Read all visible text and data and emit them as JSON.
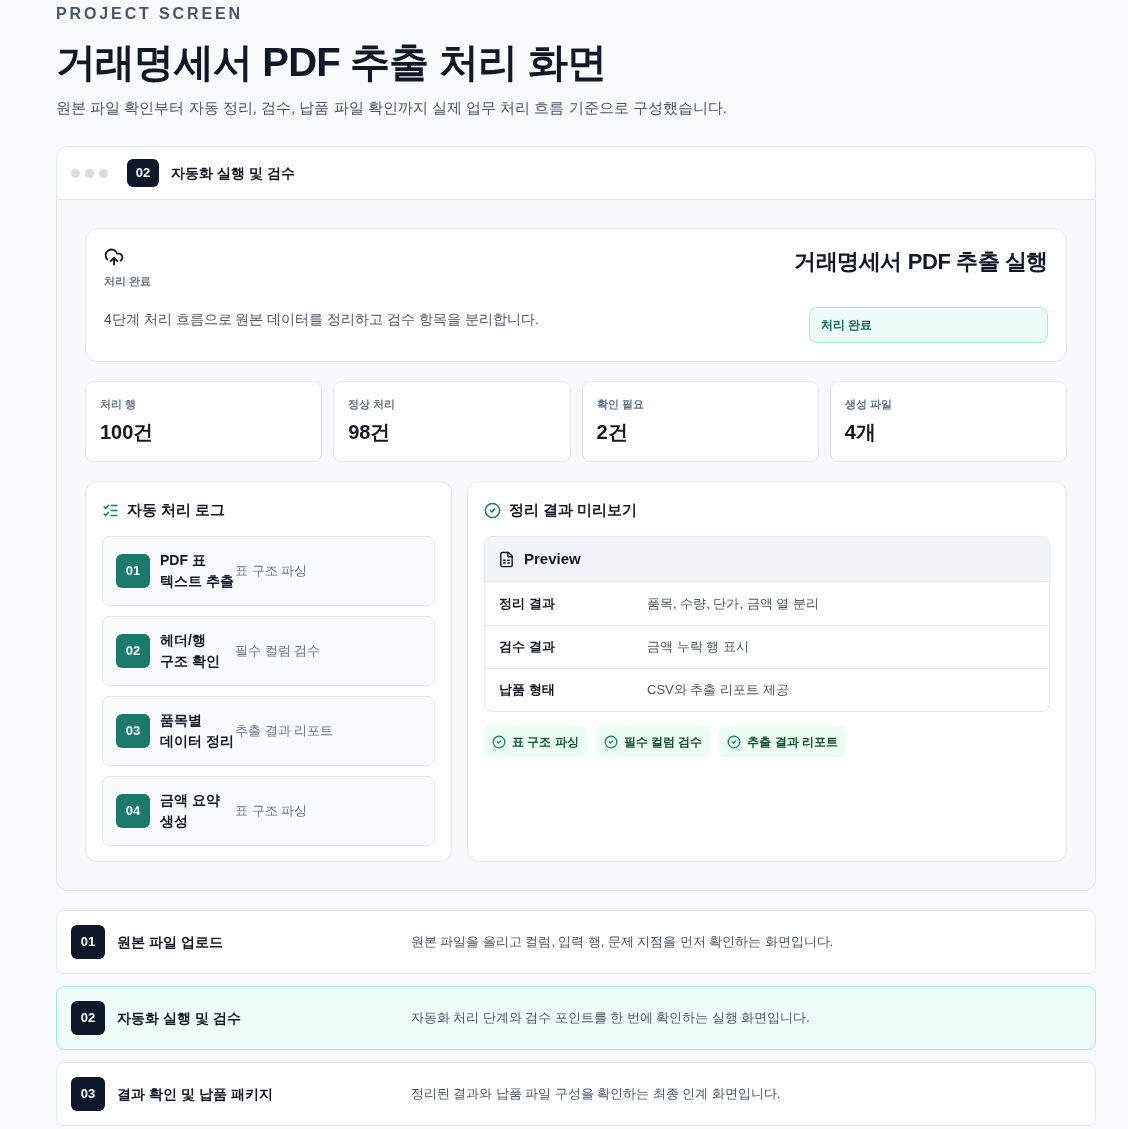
{
  "header": {
    "eyebrow": "PROJECT SCREEN",
    "title": "거래명세서 PDF 추출 처리 화면",
    "subtitle": "원본 파일 확인부터 자동 정리, 검수, 납품 파일 확인까지 실제 업무 처리 흐름 기준으로 구성했습니다."
  },
  "panel": {
    "badge": "02",
    "title": "자동화 실행 및 검수"
  },
  "summary": {
    "label": "처리 완료",
    "description": "4단계 처리 흐름으로 원본 데이터를 정리하고 검수 항목을 분리합니다.",
    "title": "거래명세서 PDF 추출 실행",
    "status": "처리 완료"
  },
  "stats": [
    {
      "label": "처리 행",
      "value": "100건"
    },
    {
      "label": "정상 처리",
      "value": "98건"
    },
    {
      "label": "확인 필요",
      "value": "2건"
    },
    {
      "label": "생성 파일",
      "value": "4개"
    }
  ],
  "log": {
    "title": "자동 처리 로그",
    "steps": [
      {
        "number": "01",
        "title": "PDF 표 텍스트 추출",
        "description": "표 구조 파싱"
      },
      {
        "number": "02",
        "title": "헤더/행 구조 확인",
        "description": "필수 컬럼 검수"
      },
      {
        "number": "03",
        "title": "품목별 데이터 정리",
        "description": "추출 결과 리포트"
      },
      {
        "number": "04",
        "title": "금액 요약 생성",
        "description": "표 구조 파싱"
      }
    ]
  },
  "preview": {
    "title": "정리 결과 미리보기",
    "table_title": "Preview",
    "rows": [
      {
        "label": "정리 결과",
        "value": "품목, 수량, 단가, 금액 열 분리"
      },
      {
        "label": "검수 결과",
        "value": "금액 누락 행 표시"
      },
      {
        "label": "납품 형태",
        "value": "CSV와 추출 리포트 제공"
      }
    ],
    "tags": [
      "표 구조 파싱",
      "필수 컬럼 검수",
      "추출 결과 리포트"
    ]
  },
  "steps": [
    {
      "number": "01",
      "title": "원본 파일 업로드",
      "description": "원본 파일을 올리고 컬럼, 입력 행, 문제 지점을 먼저 확인하는 화면입니다.",
      "selected": false
    },
    {
      "number": "02",
      "title": "자동화 실행 및 검수",
      "description": "자동화 처리 단계와 검수 포인트를 한 번에 확인하는 실행 화면입니다.",
      "selected": true
    },
    {
      "number": "03",
      "title": "결과 확인 및 납품 패키지",
      "description": "정리된 결과와 납품 파일 구성을 확인하는 최종 인계 화면입니다.",
      "selected": false
    }
  ]
}
